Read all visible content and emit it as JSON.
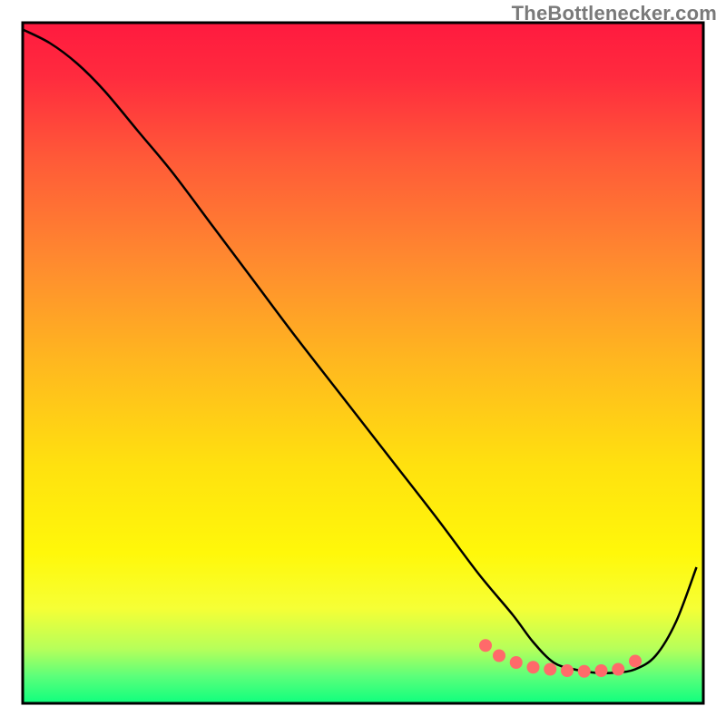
{
  "attribution": "TheBottlenecker.com",
  "chart_data": {
    "type": "line",
    "title": "",
    "xlabel": "",
    "ylabel": "",
    "xlim": [
      0,
      100
    ],
    "ylim": [
      0,
      100
    ],
    "gradient_stops": [
      {
        "offset": 0.0,
        "color": "#ff1a3f"
      },
      {
        "offset": 0.08,
        "color": "#ff2b3e"
      },
      {
        "offset": 0.2,
        "color": "#ff5a38"
      },
      {
        "offset": 0.35,
        "color": "#ff8a2f"
      },
      {
        "offset": 0.5,
        "color": "#ffb81f"
      },
      {
        "offset": 0.65,
        "color": "#ffe10f"
      },
      {
        "offset": 0.78,
        "color": "#fff80a"
      },
      {
        "offset": 0.86,
        "color": "#f6ff35"
      },
      {
        "offset": 0.92,
        "color": "#b6ff5a"
      },
      {
        "offset": 0.96,
        "color": "#5cff7a"
      },
      {
        "offset": 1.0,
        "color": "#0fff7e"
      }
    ],
    "series": [
      {
        "name": "bottleneck-curve",
        "x": [
          0,
          4,
          8,
          12,
          17,
          22,
          28,
          34,
          40,
          47,
          54,
          61,
          67,
          72,
          75,
          78,
          81,
          84,
          87,
          90,
          93,
          96,
          99
        ],
        "values": [
          99,
          97,
          94,
          90,
          84,
          78,
          70,
          62,
          54,
          45,
          36,
          27,
          19,
          13,
          9,
          6,
          5,
          4.5,
          4.5,
          5,
          7,
          12,
          20
        ]
      }
    ],
    "highlight_band": {
      "name": "optimal-range-markers",
      "color": "#ff6a6a",
      "x": [
        68,
        70,
        72.5,
        75,
        77.5,
        80,
        82.5,
        85,
        87.5,
        90
      ],
      "values": [
        8.5,
        7,
        6,
        5.3,
        5,
        4.8,
        4.7,
        4.8,
        5,
        6.2
      ]
    }
  }
}
